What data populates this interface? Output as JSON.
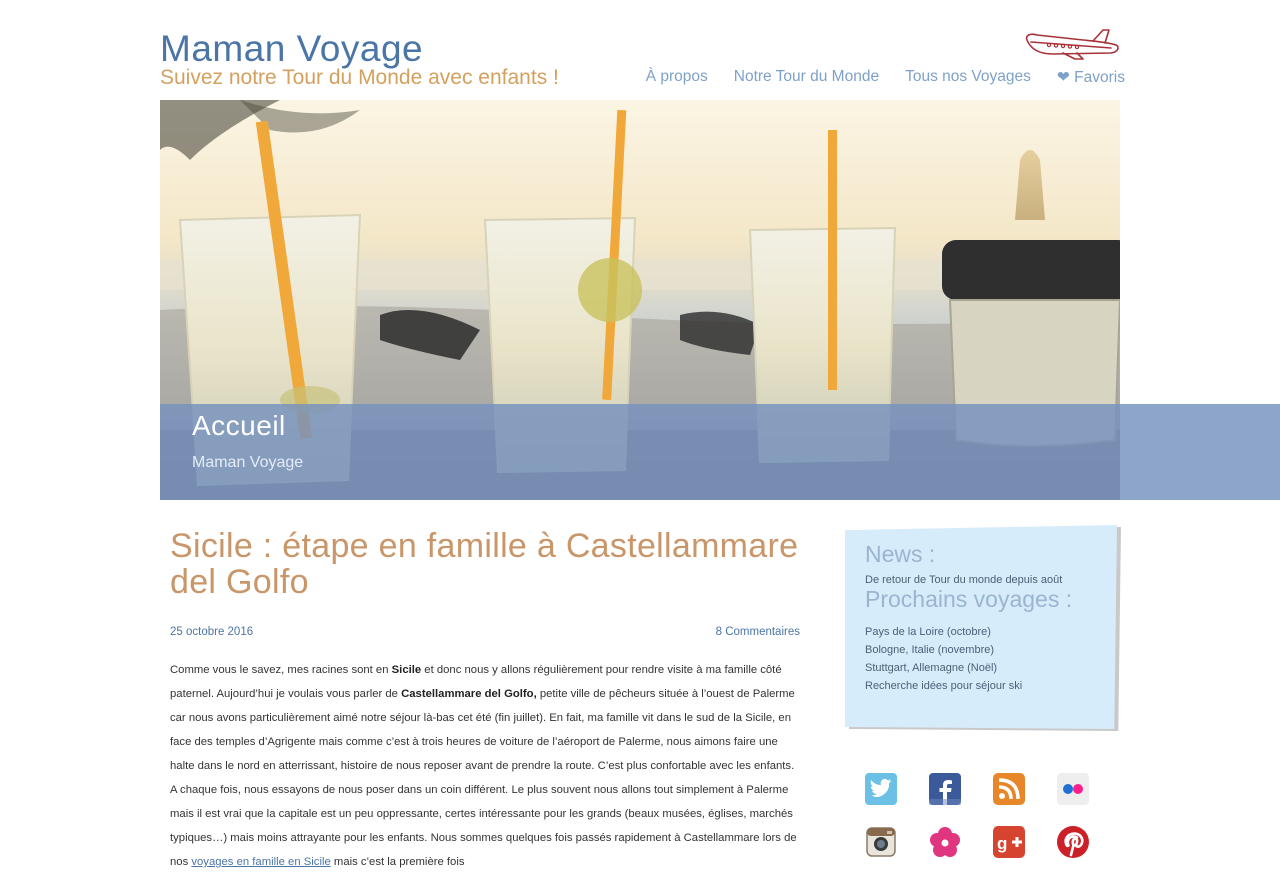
{
  "site": {
    "title": "Maman Voyage",
    "tagline": "Suivez notre Tour du Monde avec enfants !"
  },
  "nav": [
    {
      "label": "À propos"
    },
    {
      "label": "Notre Tour du Monde"
    },
    {
      "label": "Tous nos Voyages"
    },
    {
      "label": "❤ Favoris"
    }
  ],
  "hero": {
    "title": "Accueil",
    "subtitle": "Maman Voyage"
  },
  "post": {
    "title": "Sicile : étape en famille à Castellammare del Golfo",
    "date": "25 octobre 2016",
    "comments": "8 Commentaires",
    "body": {
      "t1": "Comme vous le savez, mes racines sont en ",
      "b1": "Sicile",
      "t2": " et donc nous y allons régulièrement pour rendre visite à ma famille côté paternel. Aujourd’hui je voulais vous parler de ",
      "b2": "Castellammare del Golfo,",
      "t3": " petite ville de pêcheurs située à l’ouest de Palerme car nous avons particulièrement aimé notre séjour là-bas cet été (fin juillet). En fait, ma famille vit dans le sud de la Sicile, en face des temples d’Agrigente mais comme c’est à trois heures de voiture de l’aéroport de Palerme, nous aimons faire une halte dans le nord en atterrissant, histoire de nous reposer avant de prendre la route. C’est plus confortable avec les enfants. A chaque fois, nous essayons de nous poser dans un coin différent. Le plus souvent nous allons tout simplement à Palerme mais il est vrai que la capitale est un peu oppressante, certes intéressante pour les grands (beaux musées, églises, marchés typiques…) mais moins attrayante pour les enfants. Nous sommes quelques fois passés rapidement à Castellammare lors de nos ",
      "link": "voyages en famille en Sicile",
      "t4": " mais c’est la première fois"
    }
  },
  "sidebar": {
    "news_heading": "News :",
    "news_text": "De retour de Tour du monde depuis août",
    "upcoming_heading": "Prochains voyages :",
    "upcoming": [
      {
        "label": "Pays de la Loire (octobre)"
      },
      {
        "label": "Bologne, Italie (novembre)"
      },
      {
        "label": "Stuttgart, Allemagne (Noël)"
      },
      {
        "label": "Recherche idées pour séjour ski"
      }
    ]
  },
  "social": [
    "twitter-icon",
    "facebook-icon",
    "rss-icon",
    "flickr-icon",
    "instagram-icon",
    "flower-icon",
    "google-plus-icon",
    "pinterest-icon"
  ],
  "colors": {
    "brand_blue": "#4b75a6",
    "nav_blue": "#7ea1c9",
    "tagline_orange": "#d4a05e",
    "post_title": "#c9966a",
    "band": "#7591be",
    "news_bg": "#d7ecfb"
  }
}
